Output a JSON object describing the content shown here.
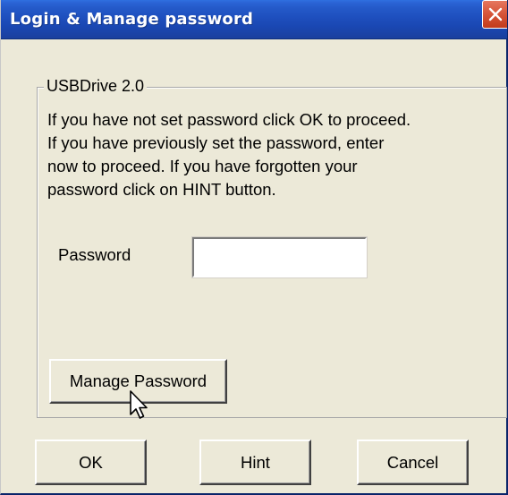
{
  "window": {
    "title": "Login & Manage password",
    "close_icon": "close-icon"
  },
  "groupbox": {
    "legend": "USBDrive 2.0",
    "instructions": [
      "If you have not set password click OK to proceed.",
      "If you have previously set  the password, enter",
      "now to proceed.  If you have forgotten your",
      "password click on HINT button."
    ]
  },
  "password": {
    "label": "Password",
    "value": ""
  },
  "buttons": {
    "manage": "Manage Password",
    "ok": "OK",
    "hint": "Hint",
    "cancel": "Cancel"
  },
  "colors": {
    "titlebar": "#2459c8",
    "dialog_bg": "#ece9d8",
    "close_button": "#d7573b"
  }
}
